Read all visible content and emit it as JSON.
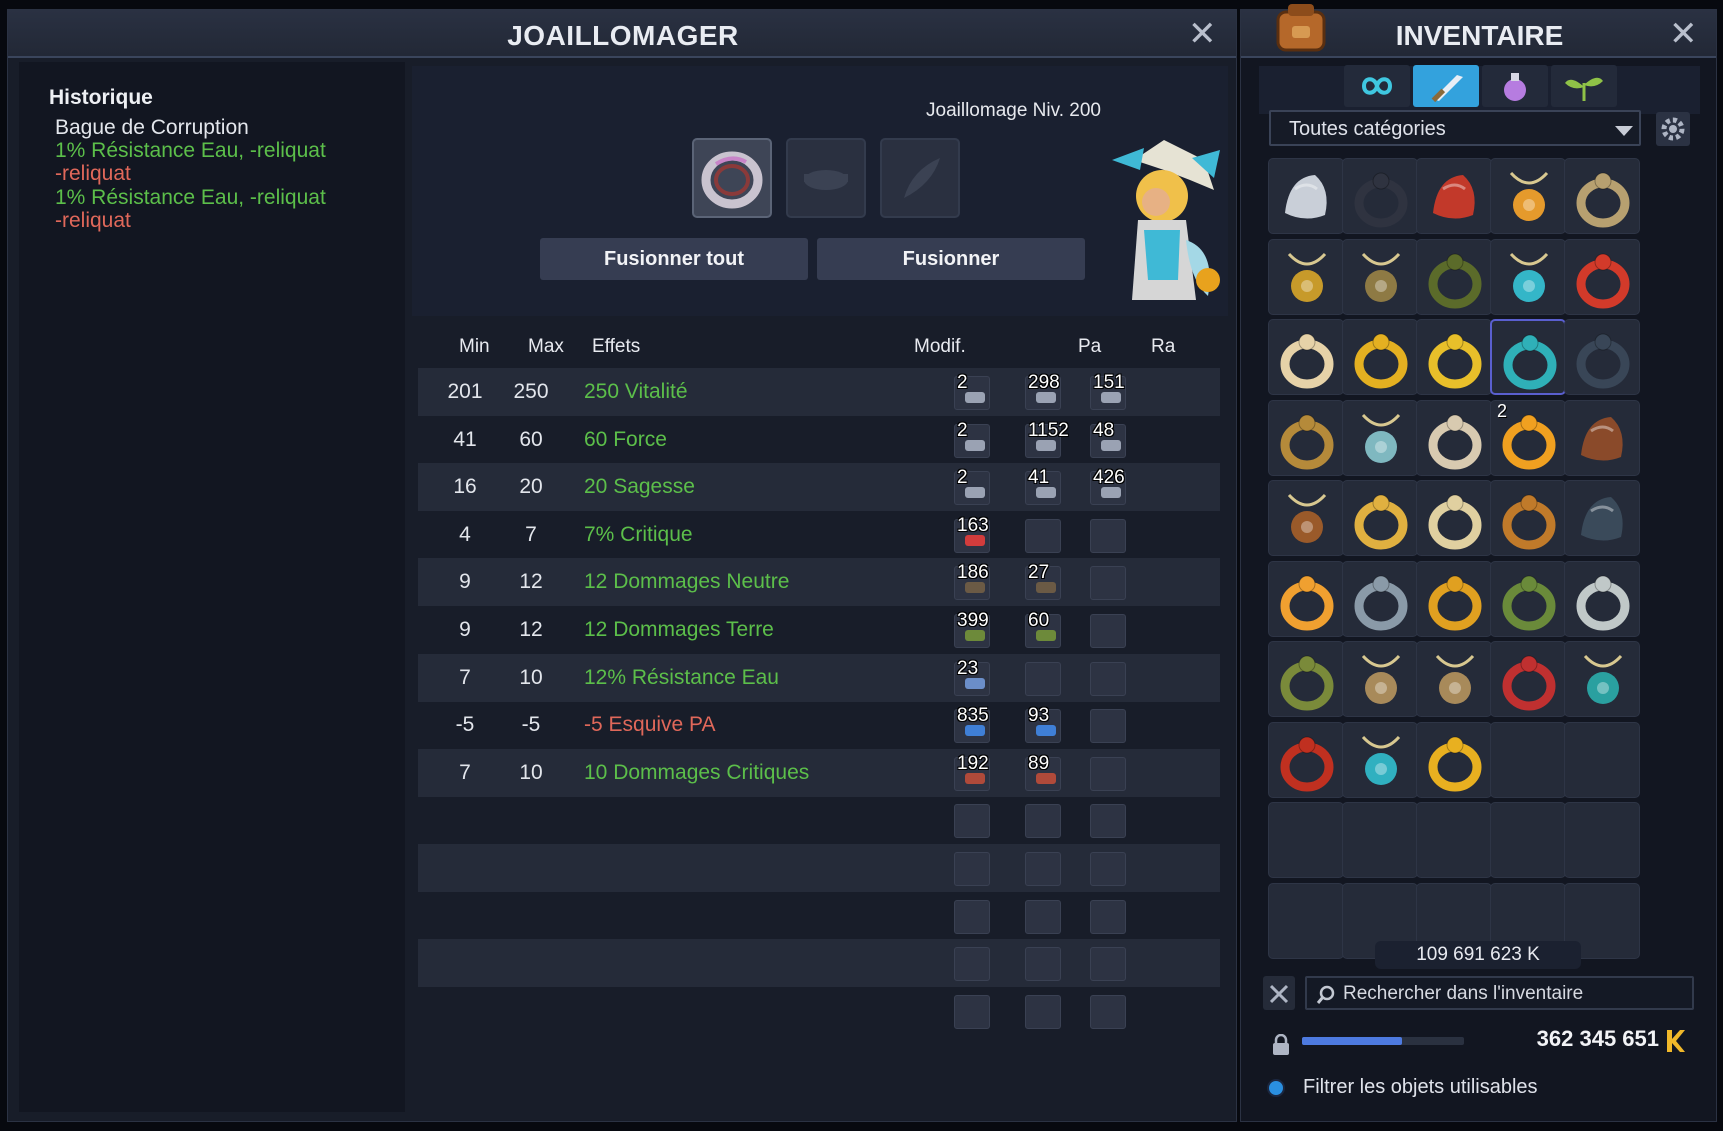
{
  "joaillomager": {
    "title": "JOAILLOMAGER",
    "close": "✕",
    "history": {
      "title": "Historique",
      "item_name": "Bague de Corruption",
      "lines": [
        {
          "text": "1% Résistance Eau, -reliquat",
          "color": "green"
        },
        {
          "text": "-reliquat",
          "color": "red"
        },
        {
          "text": "1% Résistance Eau, -reliquat",
          "color": "green"
        },
        {
          "text": "-reliquat",
          "color": "red"
        }
      ]
    },
    "level_label": "Joaillomage Niv. 200",
    "buttons": {
      "merge_all": "Fusionner tout",
      "merge": "Fusionner"
    },
    "columns": {
      "min": "Min",
      "max": "Max",
      "effects": "Effets",
      "modif": "Modif.",
      "pa": "Pa",
      "ra": "Ra"
    },
    "effects": [
      {
        "min": "201",
        "max": "250",
        "effect": "250 Vitalité",
        "color": "green",
        "rune": "2",
        "pa": "298",
        "ra": "151"
      },
      {
        "min": "41",
        "max": "60",
        "effect": "60 Force",
        "color": "green",
        "rune": "2",
        "pa": "1152",
        "ra": "48"
      },
      {
        "min": "16",
        "max": "20",
        "effect": "20 Sagesse",
        "color": "green",
        "rune": "2",
        "pa": "41",
        "ra": "426"
      },
      {
        "min": "4",
        "max": "7",
        "effect": "7% Critique",
        "color": "green",
        "rune": "163",
        "pa": "",
        "ra": ""
      },
      {
        "min": "9",
        "max": "12",
        "effect": "12 Dommages Neutre",
        "color": "green",
        "rune": "186",
        "pa": "27",
        "ra": ""
      },
      {
        "min": "9",
        "max": "12",
        "effect": "12 Dommages Terre",
        "color": "green",
        "rune": "399",
        "pa": "60",
        "ra": ""
      },
      {
        "min": "7",
        "max": "10",
        "effect": "12% Résistance Eau",
        "color": "green",
        "rune": "23",
        "pa": "",
        "ra": ""
      },
      {
        "min": "-5",
        "max": "-5",
        "effect": "-5 Esquive PA",
        "color": "red",
        "rune": "835",
        "pa": "93",
        "ra": ""
      },
      {
        "min": "7",
        "max": "10",
        "effect": "10 Dommages Critiques",
        "color": "green",
        "rune": "192",
        "pa": "89",
        "ra": ""
      }
    ],
    "empty_rows": 5
  },
  "inventory": {
    "title": "INVENTAIRE",
    "close": "✕",
    "tabs": [
      {
        "icon": "infinity-icon",
        "active": false
      },
      {
        "icon": "sword-icon",
        "active": true
      },
      {
        "icon": "potion-icon",
        "active": false
      },
      {
        "icon": "plant-icon",
        "active": false
      }
    ],
    "category": "Toutes catégories",
    "items": [
      {
        "icon": "helmet-icon",
        "qty": ""
      },
      {
        "icon": "dark-ring-icon",
        "qty": ""
      },
      {
        "icon": "red-glove-icon",
        "qty": ""
      },
      {
        "icon": "crab-amulet-icon",
        "qty": ""
      },
      {
        "icon": "gem-ring-icon",
        "qty": ""
      },
      {
        "icon": "gold-amulet-icon",
        "qty": ""
      },
      {
        "icon": "bird-amulet-icon",
        "qty": ""
      },
      {
        "icon": "bug-ring-icon",
        "qty": ""
      },
      {
        "icon": "teal-amulet-icon",
        "qty": ""
      },
      {
        "icon": "fish-ring-icon",
        "qty": ""
      },
      {
        "icon": "pearl-ring-icon",
        "qty": ""
      },
      {
        "icon": "gold-band-icon",
        "qty": ""
      },
      {
        "icon": "gold-ring-icon",
        "qty": ""
      },
      {
        "icon": "corruption-ring-icon",
        "qty": ""
      },
      {
        "icon": "spiky-ring-icon",
        "qty": ""
      },
      {
        "icon": "orbit-ring-icon",
        "qty": ""
      },
      {
        "icon": "bubble-amulet-icon",
        "qty": ""
      },
      {
        "icon": "cat-ring-icon",
        "qty": ""
      },
      {
        "icon": "orange-ring-icon",
        "qty": "2"
      },
      {
        "icon": "skewer-icon",
        "qty": ""
      },
      {
        "icon": "wood-amulet-icon",
        "qty": ""
      },
      {
        "icon": "eye-ring-icon",
        "qty": ""
      },
      {
        "icon": "shell-ring-icon",
        "qty": ""
      },
      {
        "icon": "bronze-ring-icon",
        "qty": ""
      },
      {
        "icon": "claw-icon",
        "qty": ""
      },
      {
        "icon": "pumpkin-ring-icon",
        "qty": ""
      },
      {
        "icon": "sparkle-ring-icon",
        "qty": ""
      },
      {
        "icon": "bird-ring-icon",
        "qty": ""
      },
      {
        "icon": "green-ring-icon",
        "qty": ""
      },
      {
        "icon": "sun-ring-icon",
        "qty": ""
      },
      {
        "icon": "feather-ring-icon",
        "qty": ""
      },
      {
        "icon": "skull-amulet-icon",
        "qty": ""
      },
      {
        "icon": "skull-amulet-icon",
        "qty": ""
      },
      {
        "icon": "red-belt-ring-icon",
        "qty": ""
      },
      {
        "icon": "tentacle-amulet-icon",
        "qty": ""
      },
      {
        "icon": "fire-ring-icon",
        "qty": ""
      },
      {
        "icon": "cyan-amulet-icon",
        "qty": ""
      },
      {
        "icon": "ruby-ring-icon",
        "qty": ""
      }
    ],
    "total_slots": 50,
    "selected_index": 13,
    "kamas_value": "109 691 623 K",
    "search_placeholder": "Rechercher dans l'inventaire",
    "pods_fraction": 0.62,
    "kamas_total": "362 345 651",
    "filter_label": "Filtrer les objets utilisables"
  },
  "colors": {
    "green": "#5cbf4a",
    "red": "#e0685a",
    "accent": "#33a2dd"
  }
}
